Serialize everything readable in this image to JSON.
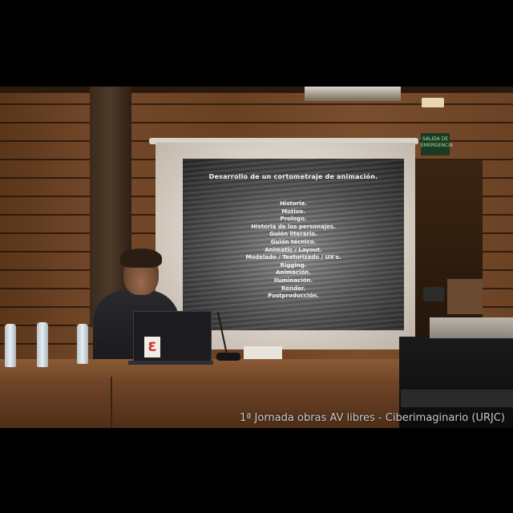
{
  "slide": {
    "title": "Desarrollo de un cortometraje de animación.",
    "items": [
      "Historia.",
      "Motivo.",
      "Prologo.",
      "Historia de los personajes.",
      "Guión literario.",
      "Guión técnico.",
      "Animatic / Layout.",
      "Modelado / Texturizado / UX's.",
      "Rigging.",
      "Animación.",
      "Iluminación.",
      "Render.",
      "Postproducción."
    ]
  },
  "laptop_sticker": "Ɛ",
  "exit_sign": "SALIDA DE EMERGENCIA",
  "caption": "1ª Jornada obras AV libres - Ciberimaginario (URJC)"
}
